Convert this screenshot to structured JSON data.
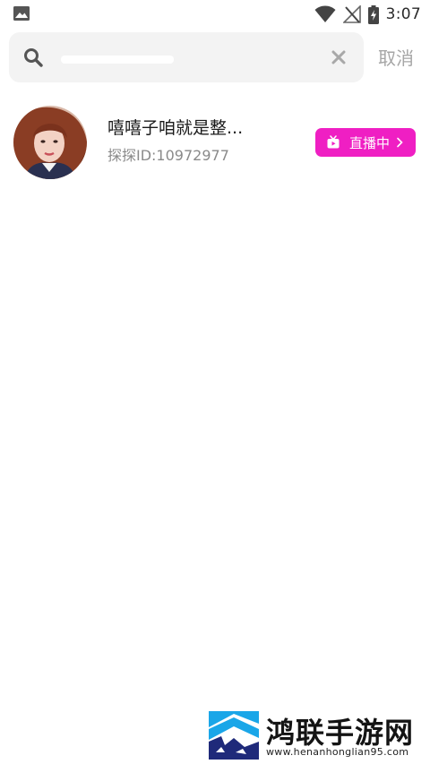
{
  "status_bar": {
    "time": "3:07",
    "icons": [
      "gallery-notification-icon",
      "wifi-icon",
      "no-signal-icon",
      "battery-charging-icon"
    ]
  },
  "search": {
    "value": "",
    "placeholder": "",
    "clear_icon": "close-icon",
    "search_icon": "search-icon",
    "cancel_label": "取消"
  },
  "results": [
    {
      "name": "嘻嘻子咱就是整...",
      "id_text": "探探ID:10972977",
      "live_label": "直播中",
      "live_color": "#ef1fc3"
    }
  ],
  "watermark": {
    "title": "鸿联手游网",
    "url": "www.henanhonglian95.com"
  }
}
